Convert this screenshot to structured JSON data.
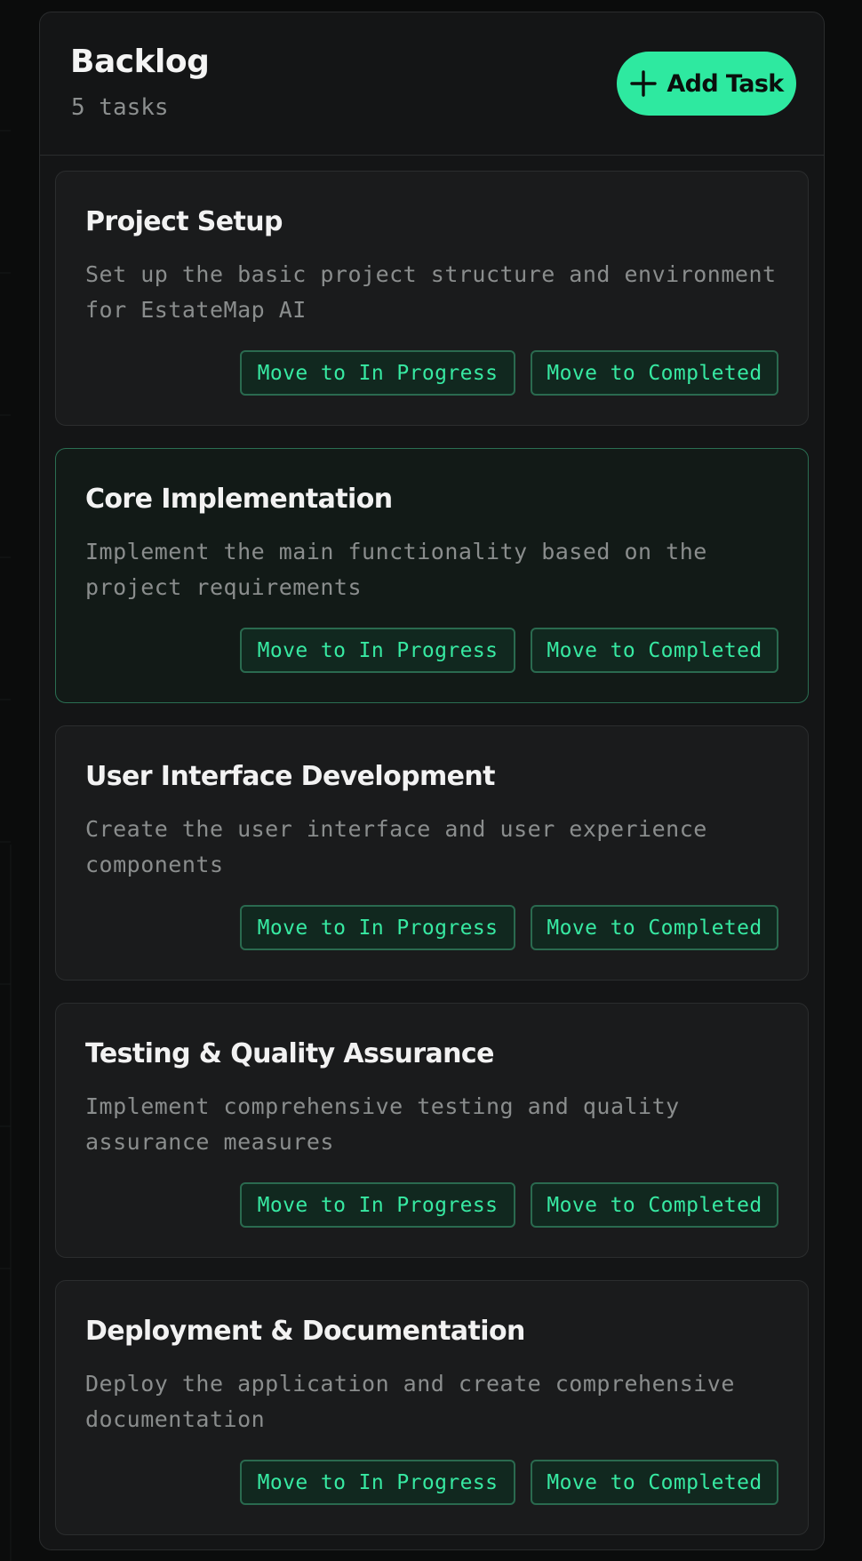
{
  "column": {
    "title": "Backlog",
    "count_label": "5 tasks",
    "add_button_label": "Add Task",
    "add_icon": "plus-icon"
  },
  "action_labels": {
    "to_in_progress": "Move to In Progress",
    "to_completed": "Move to Completed"
  },
  "tasks": [
    {
      "title": "Project Setup",
      "description": "Set up the basic project structure and environment for EstateMap AI",
      "highlighted": false
    },
    {
      "title": "Core Implementation",
      "description": "Implement the main functionality based on the project requirements",
      "highlighted": true
    },
    {
      "title": "User Interface Development",
      "description": "Create the user interface and user experience components",
      "highlighted": false
    },
    {
      "title": "Testing & Quality Assurance",
      "description": "Implement comprehensive testing and quality assurance measures",
      "highlighted": false
    },
    {
      "title": "Deployment & Documentation",
      "description": "Deploy the application and create comprehensive documentation",
      "highlighted": false
    }
  ],
  "colors": {
    "accent": "#2ee9a0",
    "page_background": "#0b0c0c",
    "panel_background": "#141516",
    "card_background": "#1a1b1c",
    "highlight_border": "#2a6e52"
  }
}
